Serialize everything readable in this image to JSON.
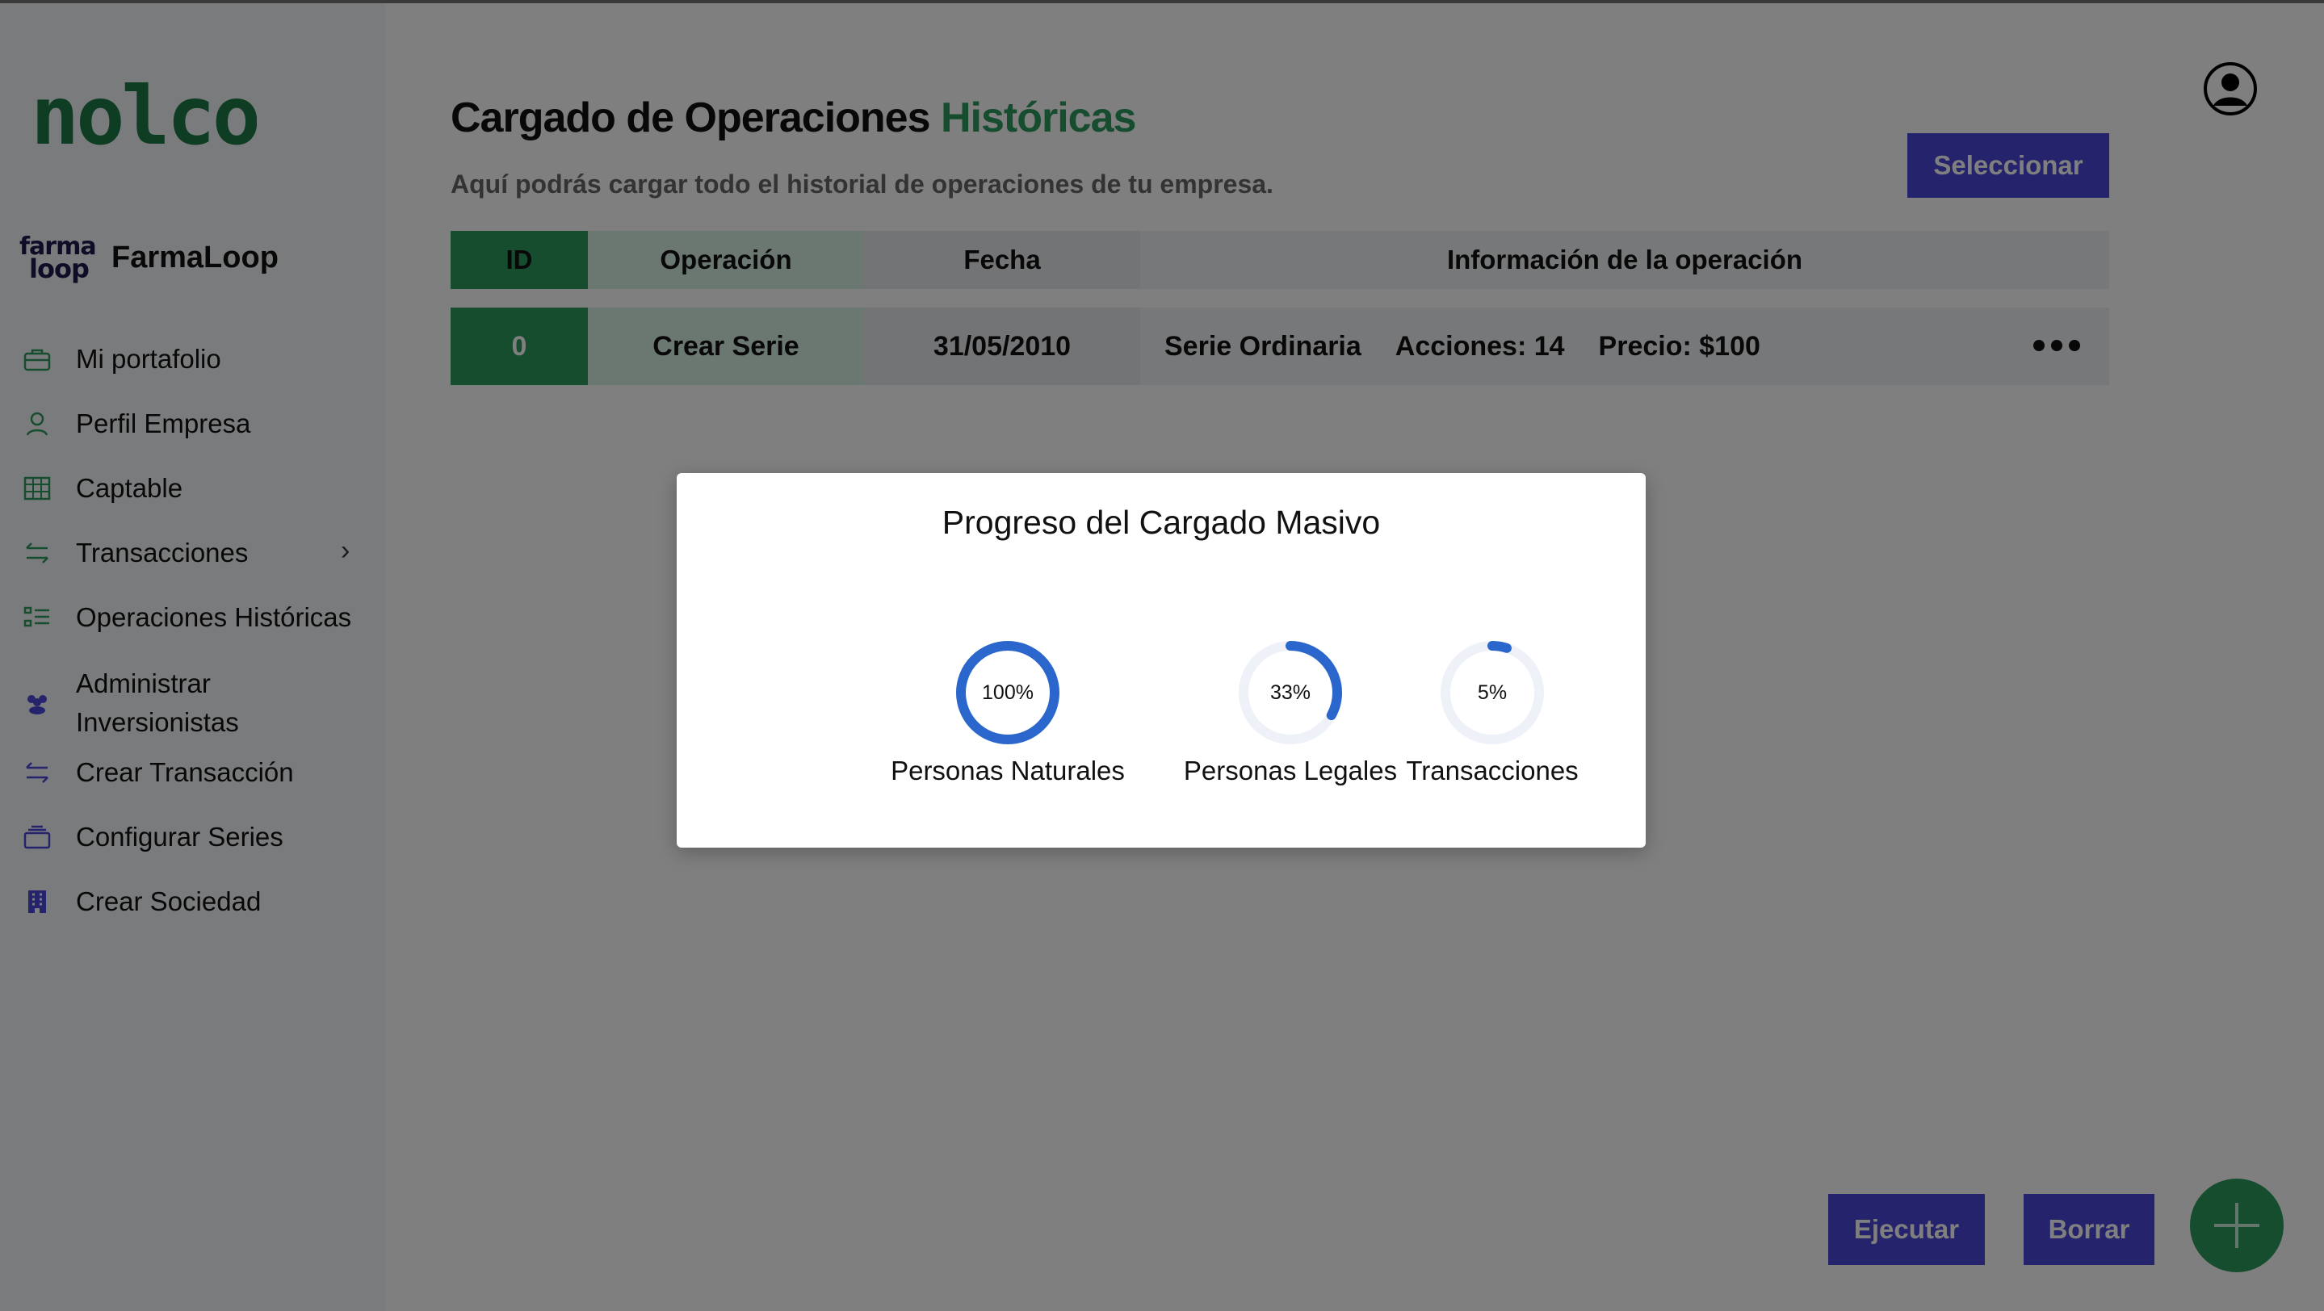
{
  "brand": {
    "name": "nolco",
    "logo_color": "#1f7a48"
  },
  "company": {
    "name": "FarmaLoop",
    "logo_top": "farma",
    "logo_bottom": "loop"
  },
  "sidebar": {
    "items": [
      {
        "label": "Mi portafolio",
        "icon": "briefcase-icon"
      },
      {
        "label": "Perfil Empresa",
        "icon": "user-icon"
      },
      {
        "label": "Captable",
        "icon": "table-icon"
      },
      {
        "label": "Transacciones",
        "icon": "transfer-icon",
        "chevron": "›"
      },
      {
        "label": "Operaciones Históricas",
        "icon": "list-icon"
      },
      {
        "label": "Administrar\nInversionistas",
        "icon": "users-icon"
      },
      {
        "label": "Crear Transacción",
        "icon": "transfer-icon"
      },
      {
        "label": "Configurar Series",
        "icon": "layers-icon"
      },
      {
        "label": "Crear Sociedad",
        "icon": "building-icon"
      }
    ]
  },
  "header": {
    "title_main": "Cargado de Operaciones",
    "title_accent": "Históricas",
    "subtitle": "Aquí podrás cargar todo el historial de operaciones de tu empresa.",
    "select_button": "Seleccionar"
  },
  "table": {
    "columns": [
      "ID",
      "Operación",
      "Fecha",
      "Información de la operación"
    ],
    "rows": [
      {
        "id": "0",
        "operation": "Crear Serie",
        "date": "31/05/2010",
        "info": [
          "Serie Ordinaria",
          "Acciones: 14",
          "Precio: $100"
        ]
      }
    ]
  },
  "actions": {
    "execute": "Ejecutar",
    "delete": "Borrar",
    "add": "+"
  },
  "modal": {
    "title": "Progreso del Cargado Masivo",
    "items": [
      {
        "label": "Personas Naturales",
        "percent": 100,
        "text": "100%"
      },
      {
        "label": "Personas Legales",
        "percent": 33,
        "text": "33%"
      },
      {
        "label": "Transacciones",
        "percent": 5,
        "text": "5%"
      }
    ]
  },
  "colors": {
    "green": "#2e9a5e",
    "purple": "#4b46d8",
    "ring_blue": "#2a66cc",
    "ring_track": "#eef2f8"
  }
}
